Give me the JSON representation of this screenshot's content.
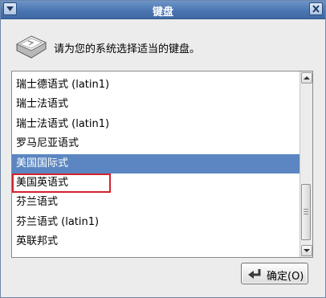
{
  "window": {
    "title": "键盘"
  },
  "header": {
    "icon": "keyboard-key-icon",
    "prompt": "请为您的系统选择适当的键盘。"
  },
  "keyboard_list": {
    "items": [
      {
        "label": "瑞士德语式 (latin1)"
      },
      {
        "label": "瑞士法语式"
      },
      {
        "label": "瑞士法语式 (latin1)"
      },
      {
        "label": "罗马尼亚语式"
      },
      {
        "label": "美国国际式"
      },
      {
        "label": "美国英语式"
      },
      {
        "label": "芬兰语式"
      },
      {
        "label": "芬兰语式 (latin1)"
      },
      {
        "label": "英联邦式"
      }
    ],
    "selected_item": "美国国际式",
    "highlighted_item": "美国英语式",
    "selection_color": "#5b86c1",
    "highlight_color": "#d4232b"
  },
  "buttons": {
    "ok_label": "确定(O)",
    "ok_icon": "enter-arrow-icon"
  },
  "colors": {
    "titlebar": "#4d78b3",
    "background": "#ececec"
  }
}
